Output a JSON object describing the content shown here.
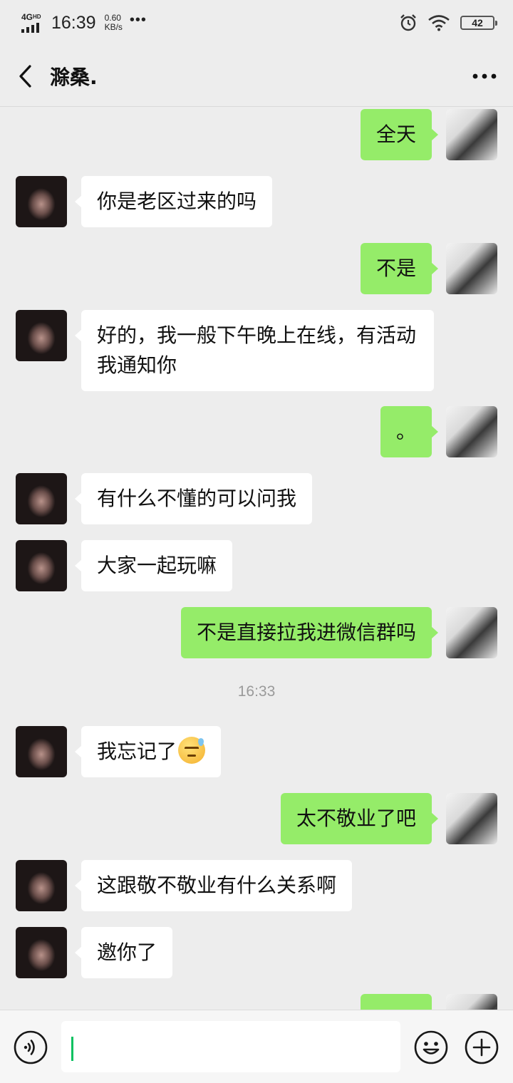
{
  "status_bar": {
    "network": "4G",
    "network_hd": "HD",
    "time": "16:39",
    "speed_value": "0.60",
    "speed_unit": "KB/s",
    "more": "•••",
    "battery": "42",
    "icons": [
      "alarm-clock-icon",
      "wifi-icon",
      "battery-icon"
    ]
  },
  "header": {
    "title": "滁桑.",
    "back_icon": "chevron-left-icon",
    "more_icon": "more-dots-icon"
  },
  "messages": [
    {
      "side": "out",
      "text": "全天"
    },
    {
      "side": "in",
      "text": "你是老区过来的吗"
    },
    {
      "side": "out",
      "text": "不是"
    },
    {
      "side": "in",
      "text": "好的，我一般下午晚上在线，有活动我通知你"
    },
    {
      "side": "out",
      "text": "。"
    },
    {
      "side": "in",
      "text": "有什么不懂的可以问我"
    },
    {
      "side": "in",
      "text": "大家一起玩嘛"
    },
    {
      "side": "out",
      "text": "不是直接拉我进微信群吗"
    },
    {
      "type": "time",
      "text": "16:33"
    },
    {
      "side": "in",
      "text": "我忘记了",
      "emoji": "sweat-smile-emoji"
    },
    {
      "side": "out",
      "text": "太不敬业了吧"
    },
    {
      "side": "in",
      "text": "这跟敬不敬业有什么关系啊"
    },
    {
      "side": "in",
      "text": "邀你了"
    }
  ],
  "input_bar": {
    "value": "",
    "voice_icon": "voice-icon",
    "emoji_icon": "emoji-icon",
    "plus_icon": "plus-icon"
  },
  "colors": {
    "background": "#ededed",
    "outgoing_bubble": "#95ec69",
    "incoming_bubble": "#ffffff",
    "caret": "#07c160"
  }
}
